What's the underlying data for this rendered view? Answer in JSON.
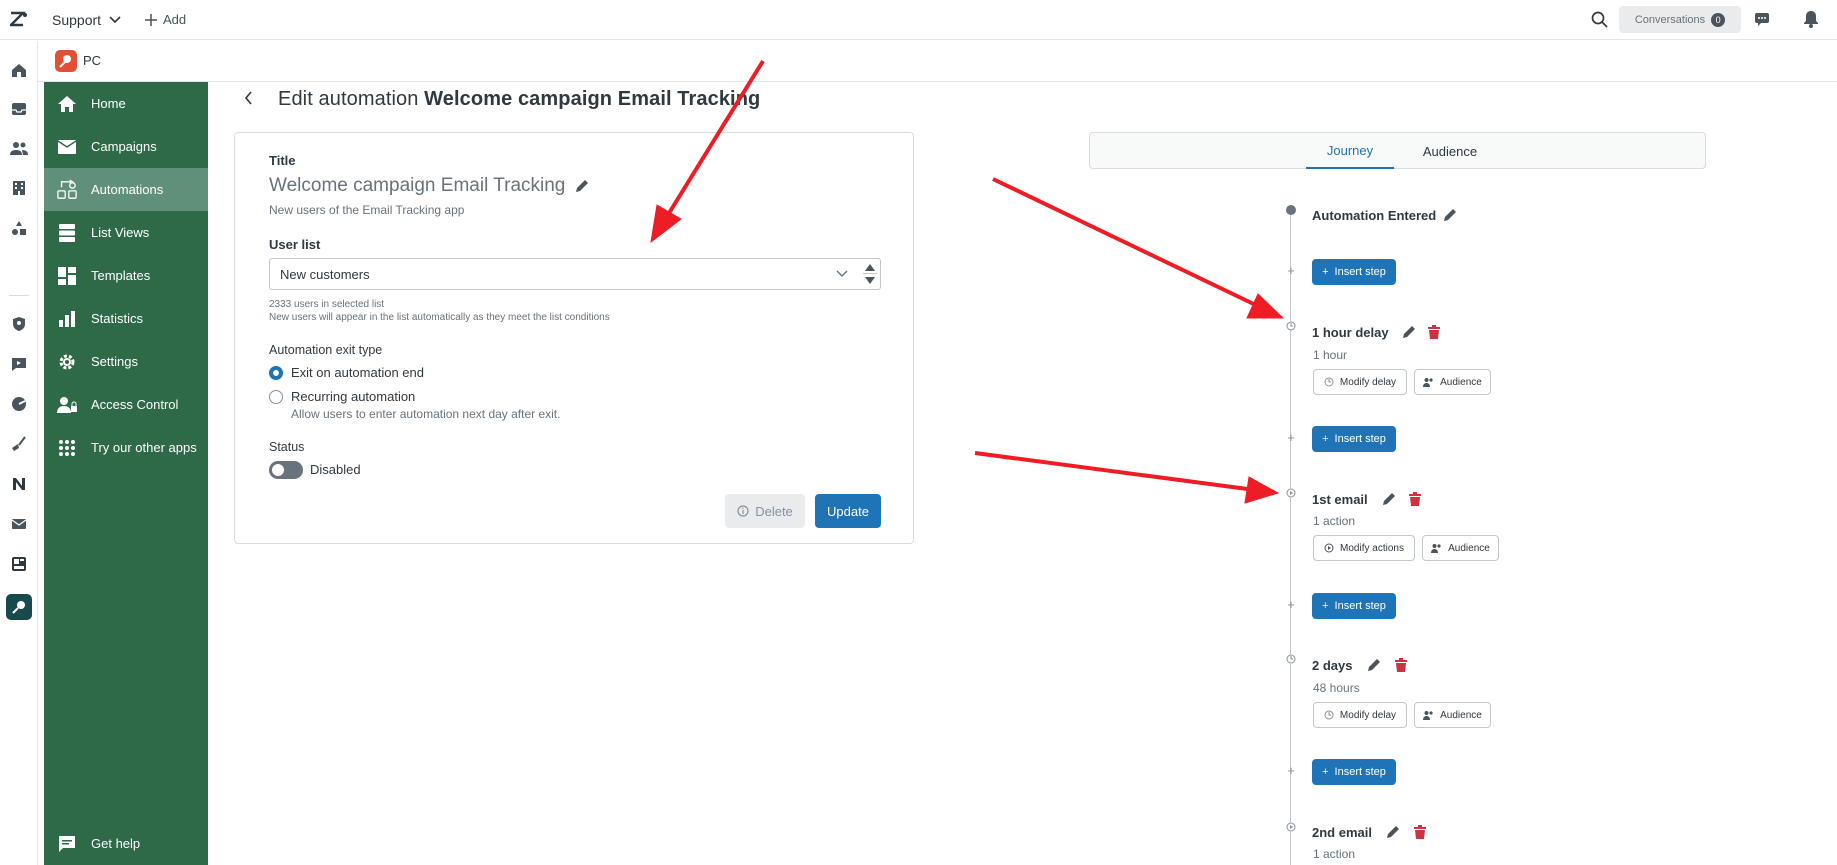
{
  "topbar": {
    "product": "Support",
    "add_label": "Add",
    "conversations_label": "Conversations",
    "conversations_count": "0"
  },
  "app": {
    "name": "PC"
  },
  "sidebar": {
    "items": [
      {
        "label": "Home",
        "icon": "home-icon"
      },
      {
        "label": "Campaigns",
        "icon": "mail-icon"
      },
      {
        "label": "Automations",
        "icon": "automations-icon"
      },
      {
        "label": "List Views",
        "icon": "list-views-icon"
      },
      {
        "label": "Templates",
        "icon": "templates-icon"
      },
      {
        "label": "Statistics",
        "icon": "statistics-icon"
      },
      {
        "label": "Settings",
        "icon": "gear-icon"
      },
      {
        "label": "Access Control",
        "icon": "access-control-icon"
      },
      {
        "label": "Try our other apps",
        "icon": "apps-grid-icon"
      }
    ],
    "help_label": "Get help"
  },
  "page": {
    "title_prefix": "Edit automation",
    "title_name": "Welcome campaign Email Tracking"
  },
  "form": {
    "title_label": "Title",
    "title_value": "Welcome campaign Email Tracking",
    "title_desc": "New users of the Email Tracking app",
    "user_list_label": "User list",
    "user_list_value": "New customers",
    "users_count_text": "2333 users in selected list",
    "users_hint": "New users will appear in the list automatically as they meet the list conditions",
    "exit_type_label": "Automation exit type",
    "exit_option_1": "Exit on automation end",
    "exit_option_2": "Recurring automation",
    "exit_option_2_desc": "Allow users to enter automation next day after exit.",
    "exit_selected": "Exit on automation end",
    "status_label": "Status",
    "status_value": "Disabled",
    "delete_label": "Delete",
    "update_label": "Update"
  },
  "journey": {
    "tabs": [
      "Journey",
      "Audience"
    ],
    "active_tab": "Journey",
    "entered_label": "Automation Entered",
    "insert_label": "Insert step",
    "steps": [
      {
        "title": "1 hour delay",
        "sub": "1 hour",
        "action_label": "Modify delay",
        "audience_label": "Audience",
        "type": "delay"
      },
      {
        "title": "1st email",
        "sub": "1 action",
        "action_label": "Modify actions",
        "audience_label": "Audience",
        "type": "email"
      },
      {
        "title": "2 days",
        "sub": "48 hours",
        "action_label": "Modify delay",
        "audience_label": "Audience",
        "type": "delay"
      },
      {
        "title": "2nd email",
        "sub": "1 action",
        "type": "email"
      }
    ]
  },
  "colors": {
    "sidebar_bg": "#2e6948",
    "sidebar_active": "#61907a",
    "primary": "#1f73b7",
    "delete_red": "#cc3340",
    "annotation_arrow": "#ee1c24"
  }
}
